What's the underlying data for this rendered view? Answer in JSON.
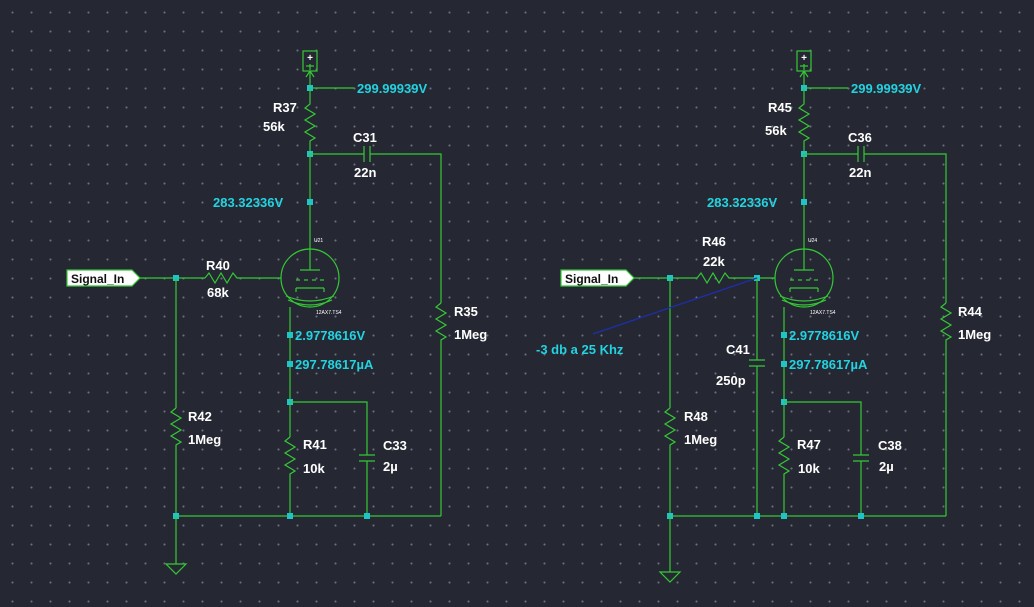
{
  "left_stage": {
    "supply_voltage": "299.99939V",
    "plate_voltage": "283.32336V",
    "cathode_voltage": "2.9778616V",
    "cathode_current": "297.78617µA",
    "input_label": "Signal_In",
    "tube": {
      "name": "U21",
      "model": "12AX7.TS4"
    },
    "r_plate": {
      "name": "R37",
      "value": "56k"
    },
    "c_coupling": {
      "name": "C31",
      "value": "22n"
    },
    "r_grid_stop": {
      "name": "R40",
      "value": "68k"
    },
    "r_load": {
      "name": "R35",
      "value": "1Meg"
    },
    "r_input": {
      "name": "R42",
      "value": "1Meg"
    },
    "r_cathode": {
      "name": "R41",
      "value": "10k"
    },
    "c_cathode": {
      "name": "C33",
      "value": "2µ"
    }
  },
  "right_stage": {
    "supply_voltage": "299.99939V",
    "plate_voltage": "283.32336V",
    "cathode_voltage": "2.9778616V",
    "cathode_current": "297.78617µA",
    "input_label": "Signal_In",
    "note": "-3 db a 25 Khz",
    "tube": {
      "name": "U24",
      "model": "12AX7.TS4"
    },
    "r_plate": {
      "name": "R45",
      "value": "56k"
    },
    "c_coupling": {
      "name": "C36",
      "value": "22n"
    },
    "r_grid_stop": {
      "name": "R46",
      "value": "22k"
    },
    "c_miller": {
      "name": "C41",
      "value": "250p"
    },
    "r_load": {
      "name": "R44",
      "value": "1Meg"
    },
    "r_input": {
      "name": "R48",
      "value": "1Meg"
    },
    "r_cathode": {
      "name": "R47",
      "value": "10k"
    },
    "c_cathode": {
      "name": "C38",
      "value": "2µ"
    }
  }
}
